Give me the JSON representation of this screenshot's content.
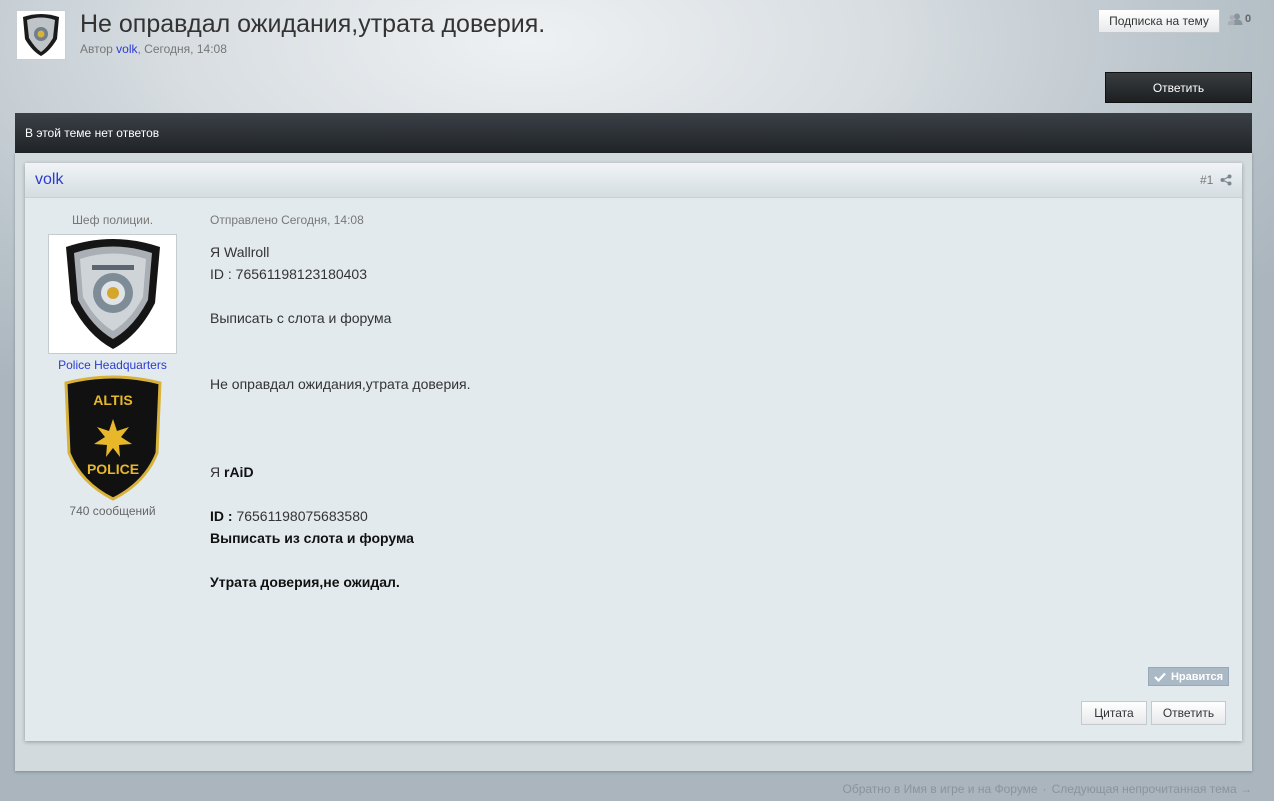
{
  "topic": {
    "title": "Не оправдал ожидания,утрата доверия.",
    "meta_prefix": "Автор",
    "author": "volk",
    "date": ", Сегодня, 14:08"
  },
  "header": {
    "follow_label": "Подписка на тему",
    "followers_count": "0",
    "reply_label": "Ответить"
  },
  "maintitle": "В этой теме нет ответов",
  "post": {
    "author": "volk",
    "number": "#1",
    "rank": "Шеф полиции.",
    "group": "Police Headquarters",
    "badge": {
      "top": "ALTIS",
      "bottom": "POLICE",
      "star_color": "#e8b82a",
      "shield_color": "#111111"
    },
    "post_count": "740 сообщений",
    "posted": "Отправлено Сегодня, 14:08",
    "lines": [
      {
        "prefix": "Я ",
        "text": "Wallroll",
        "bold": false
      },
      {
        "prefix": "",
        "text": "ID :  76561198123180403",
        "bold": false
      },
      {
        "prefix": "",
        "text": "",
        "bold": false
      },
      {
        "prefix": "",
        "text": "Выписать с слота и форума",
        "bold": false
      },
      {
        "prefix": "",
        "text": "",
        "bold": false
      },
      {
        "prefix": "",
        "text": "",
        "bold": false
      },
      {
        "prefix": "",
        "text": "Не оправдал ожидания,утрата доверия.",
        "bold": false
      },
      {
        "prefix": "",
        "text": "",
        "bold": false
      },
      {
        "prefix": "",
        "text": "",
        "bold": false
      },
      {
        "prefix": "",
        "text": "",
        "bold": false
      },
      {
        "prefix": "Я ",
        "text": "rAiD",
        "bold": true
      },
      {
        "prefix": "",
        "text": "",
        "bold": false
      },
      {
        "prefix": "ID : ",
        "text": "76561198075683580",
        "bold": false,
        "prefix_bold": true
      },
      {
        "prefix": "",
        "text": "Выписать из слота и форума",
        "bold": true
      },
      {
        "prefix": "",
        "text": "",
        "bold": false
      },
      {
        "prefix": "",
        "text": "Утрата доверия,не ожидал.",
        "bold": true
      }
    ],
    "like_label": "Нравится",
    "quote_label": "Цитата",
    "reply_label": "Ответить"
  },
  "footer": {
    "back_link": "Обратно в Имя в игре и на Форуме",
    "next_link": "Следующая непрочитанная тема →"
  },
  "colors": {
    "link": "#2b3bd1",
    "dark_bar": "#2a2f33"
  }
}
